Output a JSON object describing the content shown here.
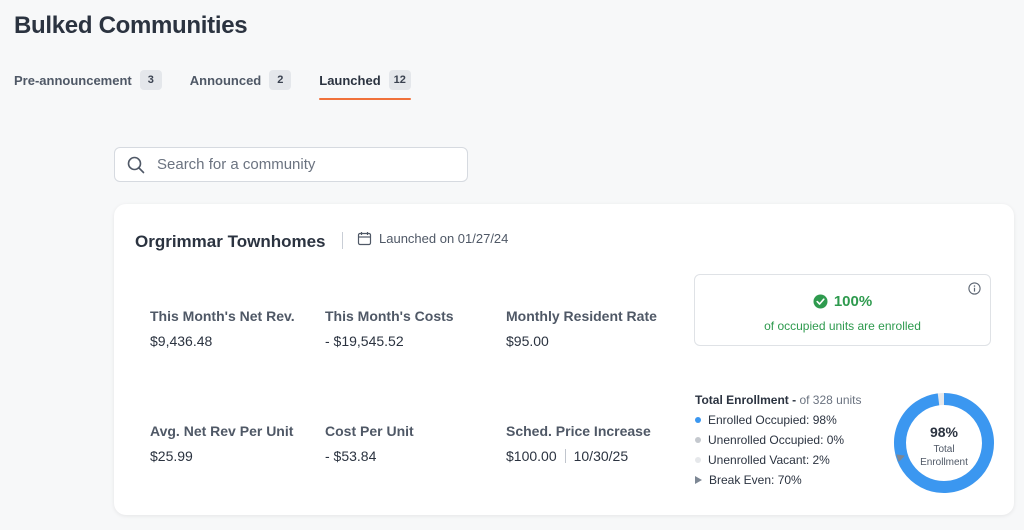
{
  "page": {
    "title": "Bulked Communities"
  },
  "tabs": [
    {
      "label": "Pre-announcement",
      "count": "3"
    },
    {
      "label": "Announced",
      "count": "2"
    },
    {
      "label": "Launched",
      "count": "12"
    }
  ],
  "search": {
    "placeholder": "Search for a community"
  },
  "community": {
    "name": "Orgrimmar Townhomes",
    "launched": "Launched on 01/27/24",
    "metrics": {
      "net_rev": {
        "label": "This Month's Net Rev.",
        "value": "$9,436.48"
      },
      "costs": {
        "label": "This Month's Costs",
        "value": "- $19,545.52"
      },
      "resident_rate": {
        "label": "Monthly Resident Rate",
        "value": "$95.00"
      },
      "avg_net_rev": {
        "label": "Avg. Net Rev Per Unit",
        "value": "$25.99"
      },
      "cost_per_unit": {
        "label": "Cost Per Unit",
        "value": "- $53.84"
      },
      "price_increase": {
        "label": "Sched. Price Increase",
        "value": "$100.00",
        "date": "10/30/25"
      }
    },
    "enrollment_box": {
      "percent": "100%",
      "subtitle": "of occupied units are enrolled"
    },
    "total_enrollment": {
      "title": "Total Enrollment -",
      "units": "of 328 units",
      "legend": [
        {
          "label": "Enrolled Occupied: 98%",
          "color": "#3b97f0"
        },
        {
          "label": "Unenrolled Occupied: 0%",
          "color": "#c4c8ce"
        },
        {
          "label": "Unenrolled Vacant: 2%",
          "color": "#e6e8eb"
        },
        {
          "label": "Break Even: 70%",
          "color": "#7d8794",
          "marker": "triangle"
        }
      ],
      "donut": {
        "percent_label": "98%",
        "label_line1": "Total",
        "label_line2": "Enrollment",
        "enrolled_pct": 98,
        "vacant_pct": 2,
        "break_even_pct": 70,
        "enrolled_color": "#3b97f0",
        "vacant_color": "#e6e8eb",
        "marker_color": "#7d8794"
      }
    }
  },
  "colors": {
    "accent": "#f0713a",
    "success": "#2e9a4e"
  },
  "icons": [
    "search-icon",
    "calendar-icon",
    "check-circle-icon",
    "info-icon",
    "break-even-marker-icon"
  ]
}
